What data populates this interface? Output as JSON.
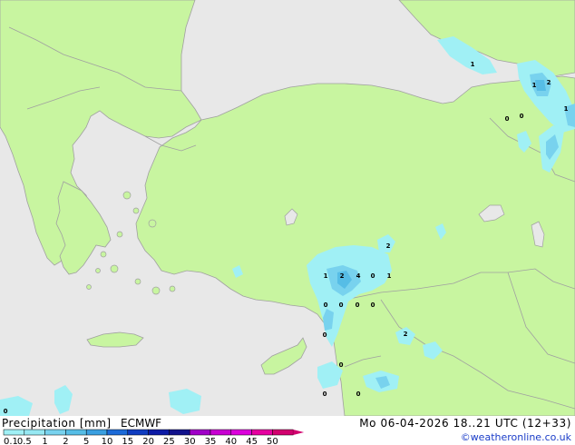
{
  "footer": {
    "legend_title": "Precipitation [mm]",
    "model": "ECMWF",
    "valid_time": "Mo 06-04-2026 18..21 UTC (12+33)",
    "credit": "©weatheronline.co.uk"
  },
  "legend": {
    "ticks": [
      "0.1",
      "0.5",
      "1",
      "2",
      "5",
      "10",
      "15",
      "20",
      "25",
      "30",
      "35",
      "40",
      "45",
      "50"
    ],
    "colors": [
      "#a0f0f5",
      "#96e8f2",
      "#78d2ee",
      "#56bde6",
      "#3a9fe0",
      "#1c6ad8",
      "#0f3cc0",
      "#0c1aa6",
      "#12128c",
      "#a000c8",
      "#c800d2",
      "#dc00dc",
      "#e600a0",
      "#d2006e"
    ]
  },
  "colors": {
    "land": "#c8f5a0",
    "sea": "#e8e8e8",
    "border": "#a0a0a0"
  },
  "map_labels": [
    "1",
    "1",
    "2",
    "1",
    "0",
    "0",
    "2",
    "1",
    "2",
    "4",
    "0",
    "1",
    "0",
    "0",
    "0",
    "0",
    "0",
    "2",
    "0",
    "0",
    "0",
    "0"
  ]
}
